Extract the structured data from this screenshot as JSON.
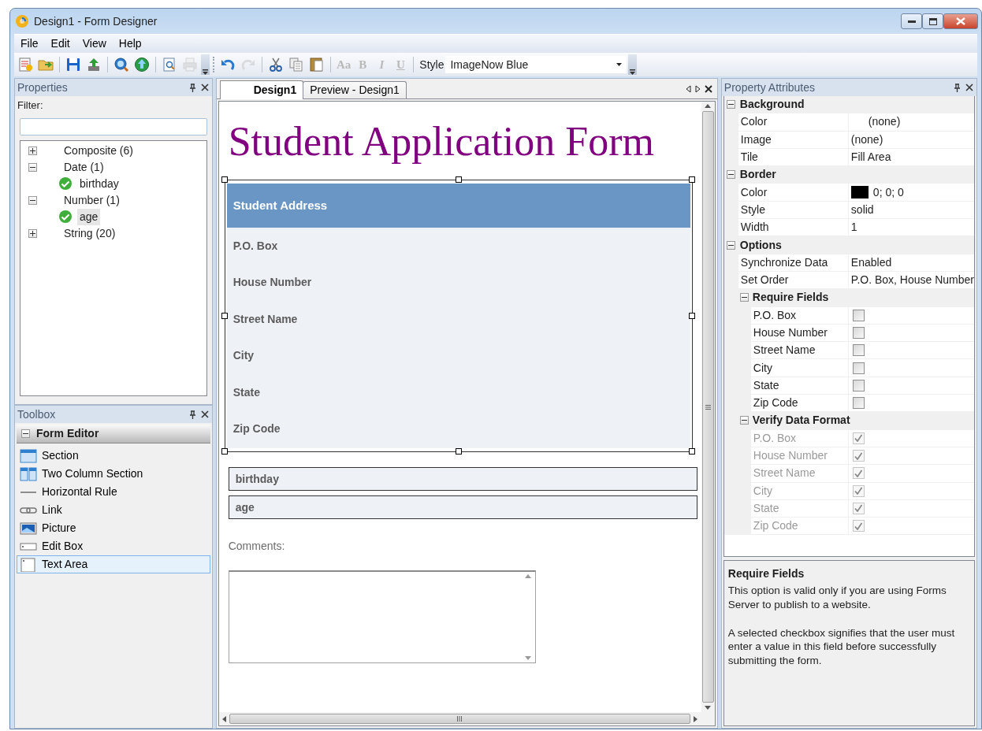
{
  "window": {
    "title": "Design1 - Form Designer"
  },
  "menu": [
    {
      "label": "File"
    },
    {
      "label": "Edit"
    },
    {
      "label": "View"
    },
    {
      "label": "Help"
    }
  ],
  "toolbar": [
    {
      "kind": "new",
      "disabled": false
    },
    {
      "kind": "open",
      "disabled": false
    },
    {
      "kind": "separator"
    },
    {
      "kind": "save",
      "disabled": false
    },
    {
      "kind": "publish",
      "disabled": false
    },
    {
      "kind": "separator"
    },
    {
      "kind": "search",
      "disabled": false
    },
    {
      "kind": "globe",
      "disabled": false
    },
    {
      "kind": "separator"
    },
    {
      "kind": "page-preview",
      "disabled": false
    },
    {
      "kind": "print",
      "disabled": true
    },
    {
      "kind": "overflow"
    },
    {
      "kind": "grip"
    },
    {
      "kind": "undo",
      "disabled": false
    },
    {
      "kind": "redo",
      "disabled": true
    },
    {
      "kind": "separator"
    },
    {
      "kind": "cut",
      "disabled": false
    },
    {
      "kind": "copy",
      "disabled": false
    },
    {
      "kind": "paste",
      "disabled": false
    },
    {
      "kind": "separator"
    },
    {
      "kind": "text",
      "label": "Aa",
      "disabled": true
    },
    {
      "kind": "text",
      "label": "B",
      "disabled": true
    },
    {
      "kind": "text",
      "label": "I",
      "disabled": true
    },
    {
      "kind": "text",
      "label": "U",
      "disabled": true
    },
    {
      "kind": "separator"
    },
    {
      "kind": "style",
      "label": "Style",
      "value": "ImageNow Blue"
    },
    {
      "kind": "overflow"
    }
  ],
  "properties": {
    "title": "Properties",
    "filter_label": "Filter:",
    "tree": [
      {
        "label": "Composite (6)",
        "expanded": false,
        "selected": false
      },
      {
        "label": "Date (1)",
        "expanded": true,
        "selected": false,
        "children": [
          {
            "label": "birthday",
            "selected": false
          }
        ]
      },
      {
        "label": "Number (1)",
        "expanded": true,
        "selected": false,
        "children": [
          {
            "label": "age",
            "selected": true
          }
        ]
      },
      {
        "label": "String (20)",
        "expanded": false,
        "selected": false
      }
    ]
  },
  "toolbox": {
    "title": "Toolbox",
    "group": {
      "label": "Form Editor",
      "expanded": true
    },
    "items": [
      {
        "label": "Section",
        "kind": "section",
        "selected": false
      },
      {
        "label": "Two Column Section",
        "kind": "two-column",
        "selected": false
      },
      {
        "label": "Horizontal Rule",
        "kind": "rule",
        "selected": false
      },
      {
        "label": "Link",
        "kind": "link",
        "selected": false
      },
      {
        "label": "Picture",
        "kind": "picture",
        "selected": false
      },
      {
        "label": "Edit Box",
        "kind": "edit-box",
        "selected": false
      },
      {
        "label": "Text Area",
        "kind": "text-area",
        "selected": true
      }
    ]
  },
  "document": {
    "tabs": [
      {
        "label": "Design1",
        "selected": true
      },
      {
        "label": "Preview - Design1",
        "selected": false
      }
    ],
    "form": {
      "title": "Student Application Form",
      "section": {
        "title": "Student Address",
        "fields": [
          "P.O. Box",
          "House Number",
          "Street Name",
          "City",
          "State",
          "Zip Code"
        ]
      },
      "fields": [
        "birthday",
        "age"
      ],
      "comments_label": "Comments:"
    }
  },
  "property_attributes": {
    "title": "Property Attributes",
    "categories": [
      {
        "label": "Background",
        "expanded": true,
        "rows": [
          {
            "name": "Color",
            "value": "(none)",
            "kind": "color"
          },
          {
            "name": "Image",
            "value": "(none)",
            "kind": "text"
          },
          {
            "name": "Tile",
            "value": "Fill Area",
            "kind": "text"
          }
        ]
      },
      {
        "label": "Border",
        "expanded": true,
        "rows": [
          {
            "name": "Color",
            "value": "0; 0; 0",
            "kind": "color",
            "color": "#000000"
          },
          {
            "name": "Style",
            "value": "solid",
            "kind": "text"
          },
          {
            "name": "Width",
            "value": "1",
            "kind": "text"
          }
        ]
      },
      {
        "label": "Options",
        "expanded": true,
        "rows": [
          {
            "name": "Synchronize Data",
            "value": "Enabled",
            "kind": "text"
          },
          {
            "name": "Set Order",
            "value": "P.O. Box, House Number",
            "kind": "text"
          }
        ],
        "subgroups": [
          {
            "label": "Require Fields",
            "expanded": true,
            "rows": [
              {
                "name": "P.O. Box",
                "checked": false,
                "disabled": false
              },
              {
                "name": "House Number",
                "checked": false,
                "disabled": false
              },
              {
                "name": "Street Name",
                "checked": false,
                "disabled": false
              },
              {
                "name": "City",
                "checked": false,
                "disabled": false
              },
              {
                "name": "State",
                "checked": false,
                "disabled": false
              },
              {
                "name": "Zip Code",
                "checked": false,
                "disabled": false
              }
            ]
          },
          {
            "label": "Verify Data Format",
            "expanded": true,
            "rows": [
              {
                "name": "P.O. Box",
                "checked": true,
                "disabled": true
              },
              {
                "name": "House Number",
                "checked": true,
                "disabled": true
              },
              {
                "name": "Street Name",
                "checked": true,
                "disabled": true
              },
              {
                "name": "City",
                "checked": true,
                "disabled": true
              },
              {
                "name": "State",
                "checked": true,
                "disabled": true
              },
              {
                "name": "Zip Code",
                "checked": true,
                "disabled": true
              }
            ]
          }
        ]
      }
    ],
    "help": {
      "title": "Require Fields",
      "paragraphs": [
        "This option is valid only if you are using Forms Server to publish to a website.",
        "A selected checkbox signifies that the user must enter a value in this field before successfully submitting the form."
      ]
    }
  }
}
